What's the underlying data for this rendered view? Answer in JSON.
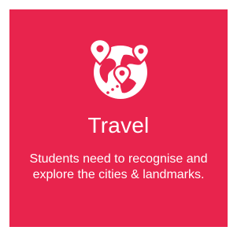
{
  "card": {
    "background_color": "#e8244d",
    "text_color": "#ffffff",
    "icon": "globe-with-location-pins-icon",
    "title": "Travel",
    "description": "Students need to recognise and explore the cities & landmarks."
  }
}
